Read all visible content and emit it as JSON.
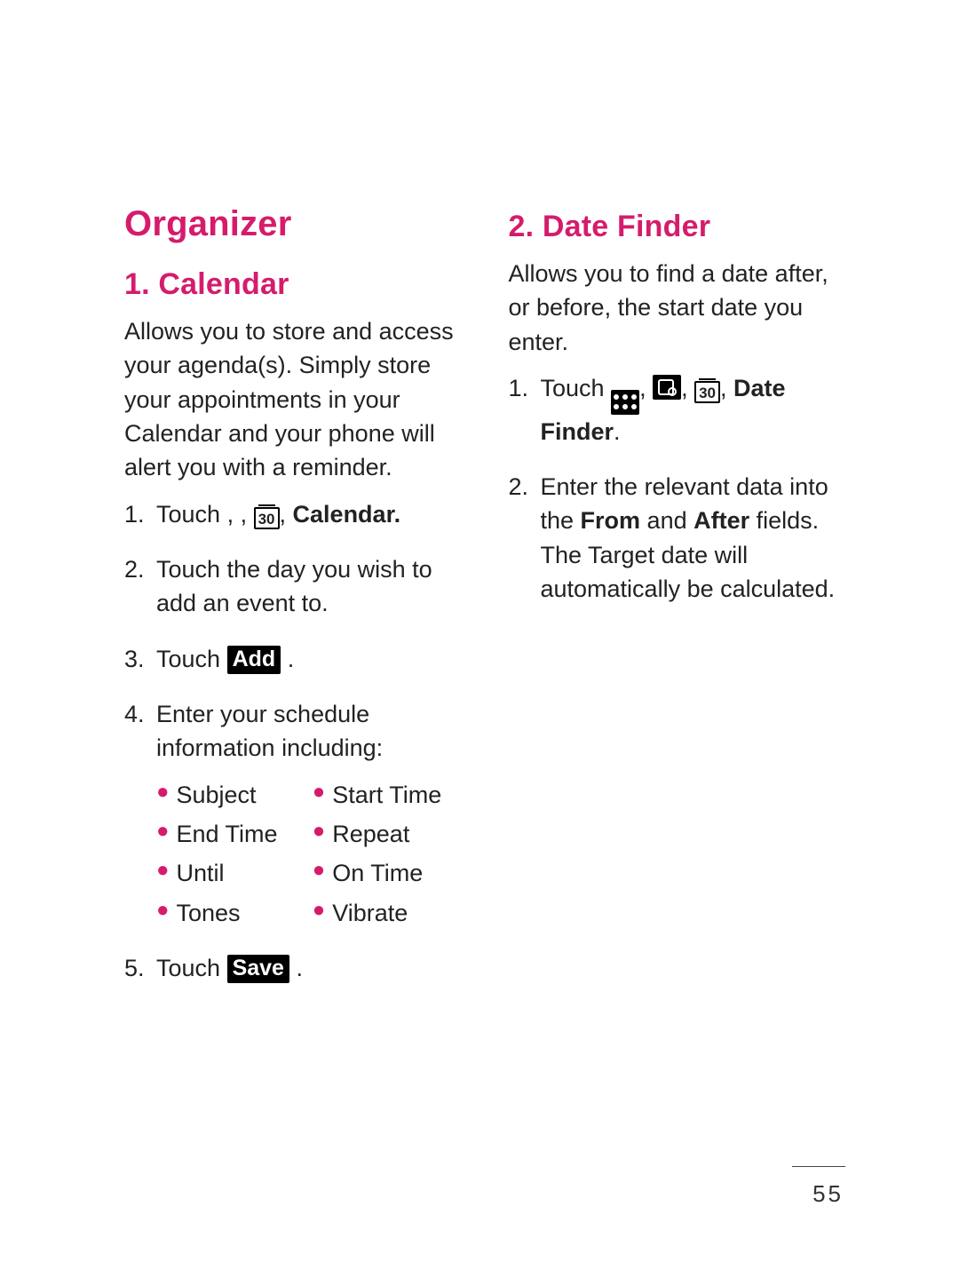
{
  "page_number": "55",
  "left": {
    "title": "Organizer",
    "h2": "1. Calendar",
    "intro": "Allows you to store and access your agenda(s). Simply store your appointments in your Calendar and your phone will alert you with a reminder.",
    "steps": {
      "s1_num": "1.",
      "s1_a": "Touch ",
      "s1_b": ", ",
      "s1_c": ", ",
      "s1_d": ", ",
      "s1_bold": "Calendar.",
      "icon30": "30",
      "s2_num": "2.",
      "s2": "Touch the day you wish to add an event to.",
      "s3_num": "3.",
      "s3_a": "Touch ",
      "s3_btn": "Add",
      "s3_b": ".",
      "s4_num": "4.",
      "s4": "Enter your schedule information including:",
      "bullets": {
        "b1": "Subject",
        "b2": "Start Time",
        "b3": "End Time",
        "b4": "Repeat",
        "b5": "Until",
        "b6": "On Time",
        "b7": "Tones",
        "b8": "Vibrate"
      },
      "s5_num": "5.",
      "s5_a": "Touch ",
      "s5_btn": "Save",
      "s5_b": "."
    }
  },
  "right": {
    "h2": "2. Date Finder",
    "intro": "Allows you to find a date after, or before, the start date you enter.",
    "steps": {
      "s1_num": "1.",
      "s1_a": "Touch ",
      "s1_b": ", ",
      "s1_c": ", ",
      "s1_d": ", ",
      "s1_bold": "Date Finder",
      "s1_e": ".",
      "icon30": "30",
      "s2_num": "2.",
      "s2_a": "Enter the relevant data into the ",
      "s2_bold1": "From",
      "s2_b": " and ",
      "s2_bold2": "After",
      "s2_c": " fields. The Target date will automatically be calculated."
    }
  }
}
